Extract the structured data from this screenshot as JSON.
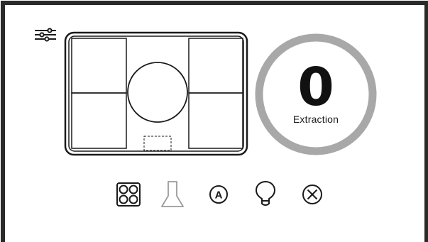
{
  "extraction": {
    "value": "0",
    "label": "Extraction",
    "ring_color": "#a8a8a8"
  },
  "toolbar": {
    "settings_icon": "sliders-icon",
    "buttons": [
      {
        "icon": "hob-zones-icon"
      },
      {
        "icon": "hood-icon",
        "state": "inactive"
      },
      {
        "icon": "auto-mode-icon",
        "glyph": "A"
      },
      {
        "icon": "light-bulb-icon"
      },
      {
        "icon": "close-circle-icon"
      }
    ]
  },
  "colors": {
    "frame": "#2a2a2a",
    "stroke": "#1a1a1a",
    "inactive": "#9a9a9a",
    "background": "#ffffff"
  }
}
